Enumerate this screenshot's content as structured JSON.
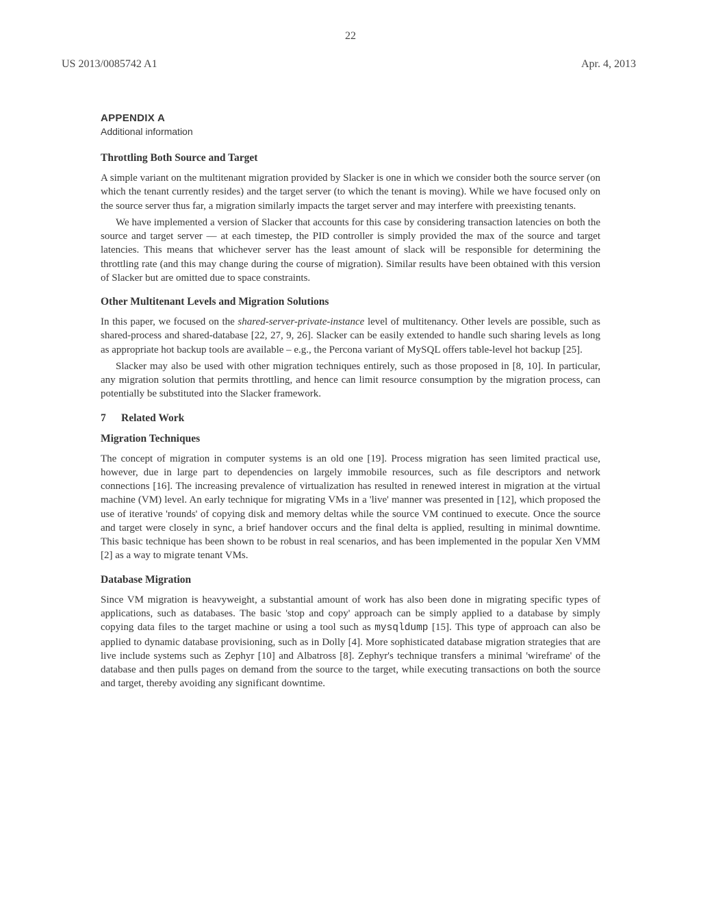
{
  "header": {
    "left": "US 2013/0085742 A1",
    "right": "Apr. 4, 2013",
    "page_num": "22"
  },
  "appendix": {
    "label": "APPENDIX A",
    "sub": "Additional information"
  },
  "s1": {
    "title": "Throttling Both Source and Target",
    "p1": "A simple variant on the multitenant migration provided by Slacker is one in which we consider both the source server (on which the tenant currently resides) and the target server (to which the tenant is moving). While we have focused only on the source server thus far, a migration similarly impacts the target server and may interfere with preexisting tenants.",
    "p2": "We have implemented a version of Slacker that accounts for this case by considering transaction latencies on both the source and target server — at each timestep, the PID controller is simply provided the max of the source and target latencies. This means that whichever server has the least amount of slack will be responsible for determining the throttling rate (and this may change during the course of migration). Similar results have been obtained with this version of Slacker but are omitted due to space constraints."
  },
  "s2": {
    "title": "Other Multitenant Levels and Migration Solutions",
    "p1a": "In this paper, we focused on the ",
    "p1i": "shared-server-private-instance",
    "p1b": " level of multitenancy. Other levels are possible, such as shared-process and shared-database [22, 27, 9, 26]. Slacker can be easily extended to handle such sharing levels as long as appropriate hot backup tools are available – e.g., the Percona variant of MySQL offers table-level hot backup [25].",
    "p2": "Slacker may also be used with other migration techniques entirely, such as those proposed in [8, 10]. In particular, any migration solution that permits throttling, and hence can limit resource consumption by the migration process, can potentially be substituted into the Slacker framework."
  },
  "s3": {
    "num": "7",
    "title": "Related Work"
  },
  "s4": {
    "title": "Migration Techniques",
    "p1": "The concept of migration in computer systems is an old one [19]. Process migration has seen limited practical use, however, due in large part to dependencies on largely immobile resources, such as file descriptors and network connections [16]. The increasing prevalence of virtualization has resulted in renewed interest in migration at the virtual machine (VM) level. An early technique for migrating VMs in a 'live' manner was presented in [12], which proposed the use of iterative 'rounds' of copying disk and memory deltas while the source VM continued to execute. Once the source and target were closely in sync, a brief handover occurs and the final delta is applied, resulting in minimal downtime. This basic technique has been shown to be robust in real scenarios, and has been implemented in the popular Xen VMM [2] as a way to migrate tenant VMs."
  },
  "s5": {
    "title": "Database Migration",
    "p1a": "Since VM migration is heavyweight, a substantial amount of work has also been done in migrating specific types of applications, such as databases. The basic 'stop and copy' approach can be simply applied to a database by simply copying data files to the target machine or using a tool such as ",
    "p1code": "mysqldump",
    "p1b": " [15]. This type of approach can also be applied to dynamic database provisioning, such as in Dolly [4]. More sophisticated database migration strategies that are live include systems such as Zephyr [10] and Albatross [8]. Zephyr's technique transfers a minimal 'wireframe' of the database and then pulls pages on demand from the source to the target, while executing transactions on both the source and target, thereby avoiding any significant downtime."
  }
}
